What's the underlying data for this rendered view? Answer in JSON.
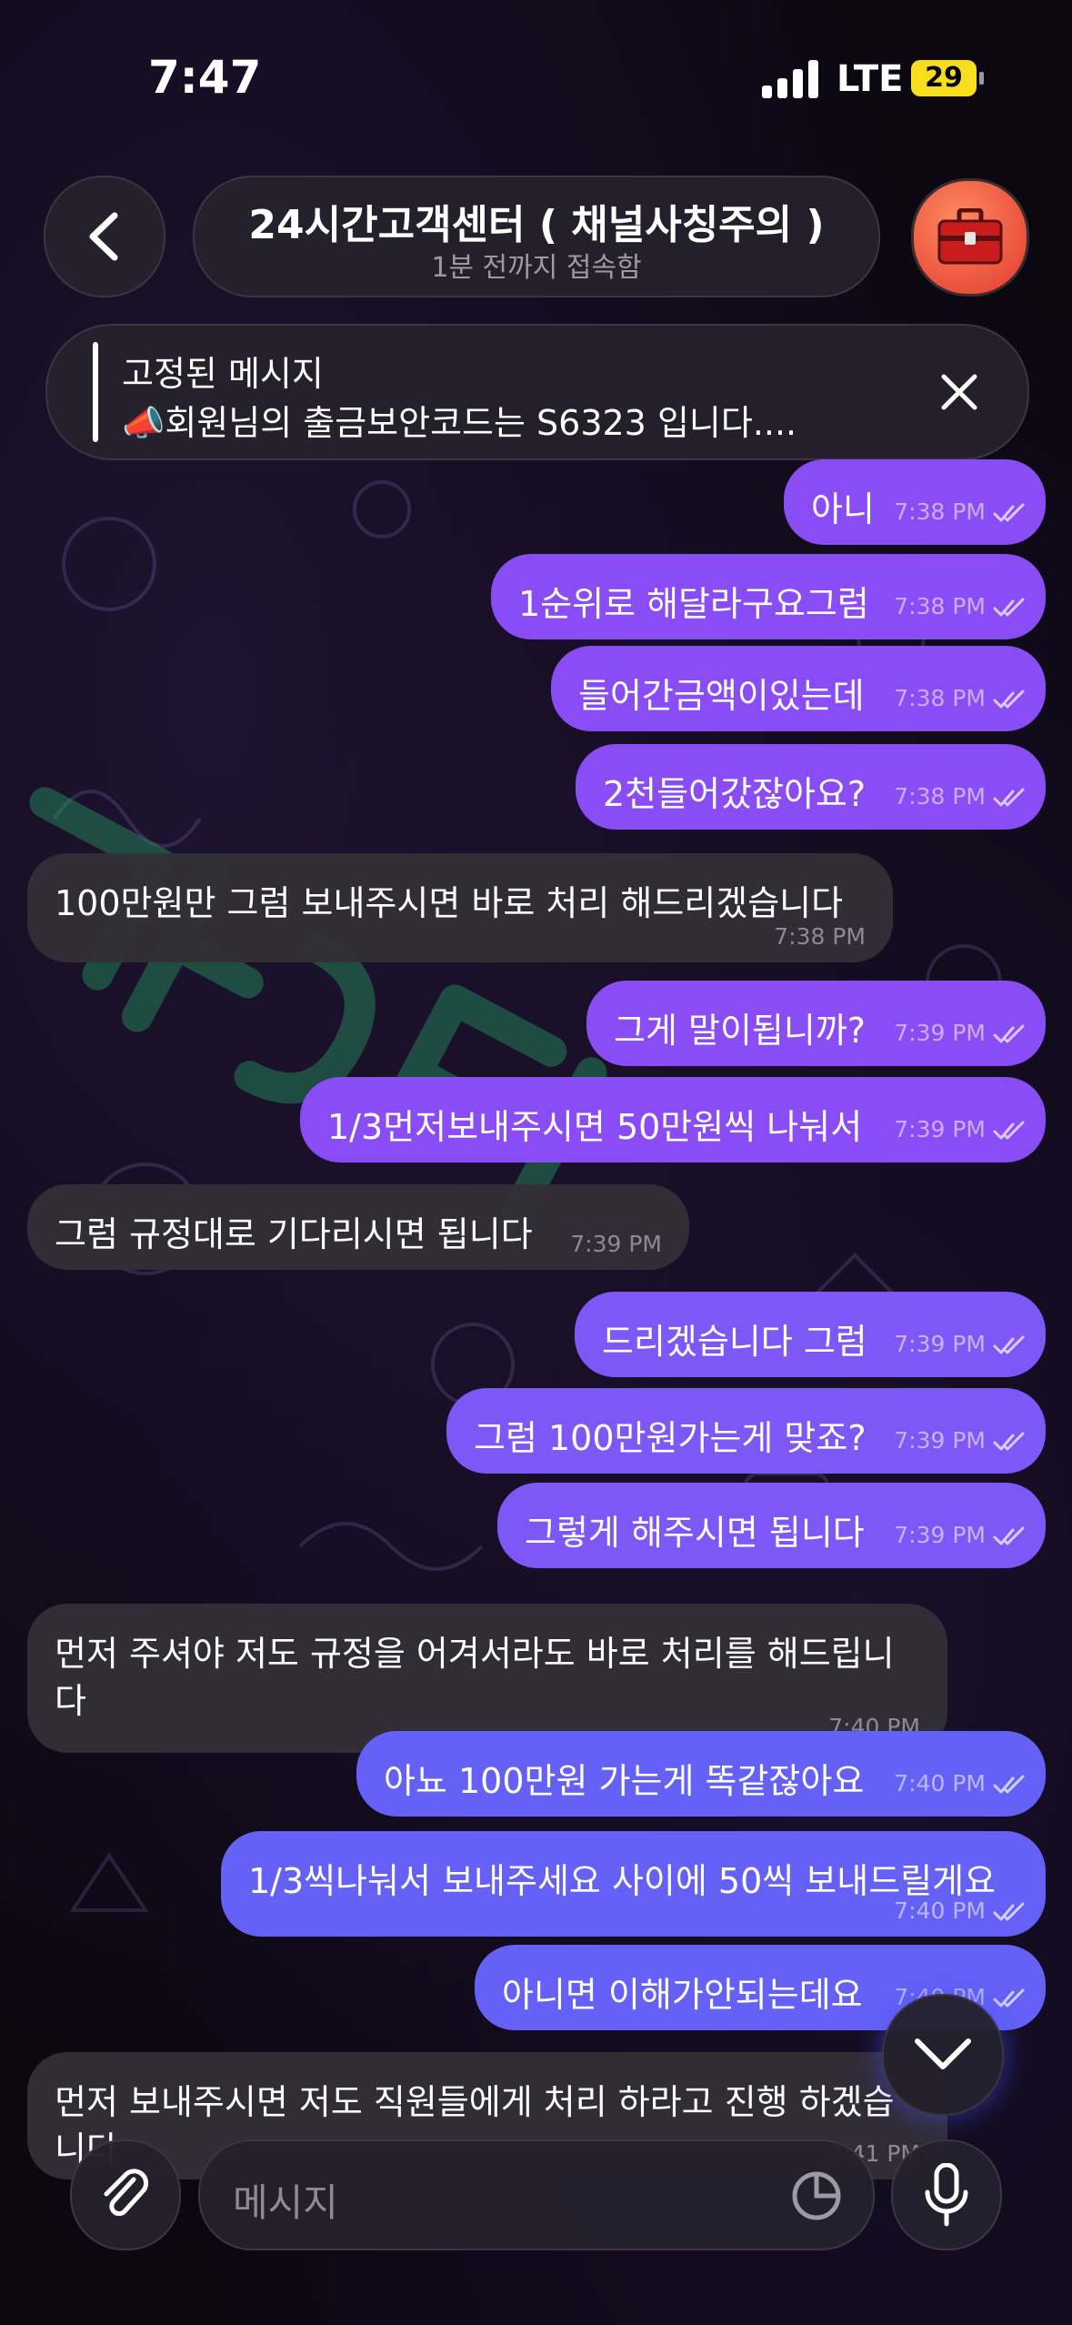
{
  "status_bar": {
    "time": "7:47",
    "network": "LTE",
    "battery": "29"
  },
  "header": {
    "title": "24시간고객센터 ( 채널사칭주의 )",
    "status": "1분 전까지 접속함"
  },
  "pinned": {
    "title": "고정된 메시지",
    "text": "📣회원님의 출금보안코드는 S6323 입니다...."
  },
  "messages": [
    {
      "side": "out",
      "text": "아니",
      "time": "7:38 PM"
    },
    {
      "side": "out",
      "text": "1순위로 해달라구요그럼",
      "time": "7:38 PM"
    },
    {
      "side": "out",
      "text": "들어간금액이있는데",
      "time": "7:38 PM"
    },
    {
      "side": "out",
      "text": "2천들어갔잖아요?",
      "time": "7:38 PM"
    },
    {
      "side": "in",
      "text": "100만원만 그럼 보내주시면 바로 처리 해드리겠습니다",
      "time": "7:38 PM"
    },
    {
      "side": "out",
      "text": "그게 말이됩니까?",
      "time": "7:39 PM"
    },
    {
      "side": "out",
      "text": "1/3먼저보내주시면 50만원씩 나눠서",
      "time": "7:39 PM"
    },
    {
      "side": "in",
      "text": "그럼 규정대로 기다리시면 됩니다",
      "time": "7:39 PM"
    },
    {
      "side": "out",
      "text": "드리겠습니다 그럼",
      "time": "7:39 PM"
    },
    {
      "side": "out",
      "text": "그럼 100만원가는게 맞죠?",
      "time": "7:39 PM"
    },
    {
      "side": "out",
      "text": "그렇게 해주시면 됩니다",
      "time": "7:39 PM"
    },
    {
      "side": "in",
      "text": "먼저 주셔야 저도 규정을 어겨서라도 바로 처리를 해드립니",
      "text2": "다",
      "time": "7:40 PM"
    },
    {
      "side": "out",
      "text": "아뇨 100만원 가는게 똑같잖아요",
      "time": "7:40 PM"
    },
    {
      "side": "out",
      "text": "1/3씩나눠서 보내주세요 사이에 50씩 보내드릴게요",
      "time": "7:40 PM"
    },
    {
      "side": "out",
      "text": "아니면 이해가안되는데요",
      "time": "7:40 PM"
    },
    {
      "side": "in",
      "text": "먼저 보내주시면 저도 직원들에게 처리 하라고 진행 하겠습",
      "text2": "니다",
      "time": "7:41 PM"
    }
  ],
  "composer": {
    "placeholder": "메시지"
  },
  "icons": {
    "back": "chevron-left-icon",
    "avatar": "toolbox-icon",
    "close": "close-icon",
    "scroll": "chevron-down-icon",
    "attach": "paperclip-icon",
    "sticker": "sticker-icon",
    "mic": "microphone-icon"
  },
  "colors": {
    "outgoing": "#8a4cf5",
    "incoming": "#322e38",
    "background": "#0b0812",
    "battery": "#f8dd1d"
  }
}
